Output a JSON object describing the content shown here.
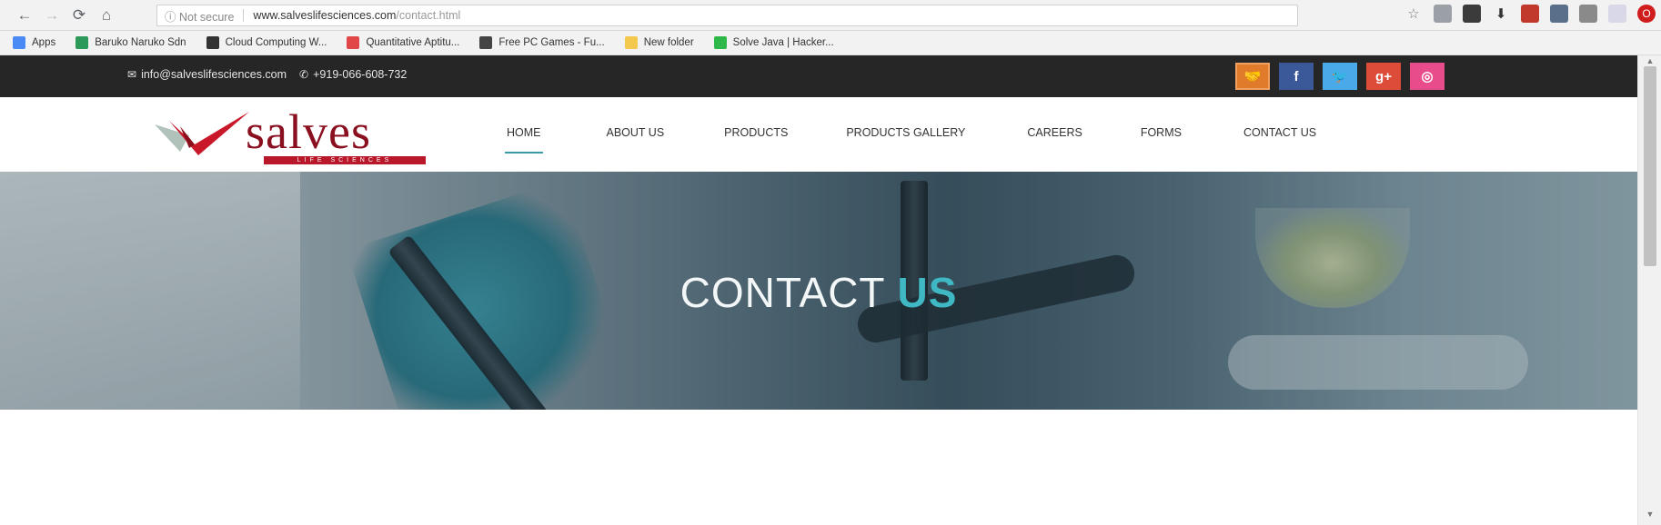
{
  "browser": {
    "nav": {
      "back": "←",
      "forward": "→",
      "reload": "⟳",
      "home": "⌂"
    },
    "security_label": "ⓘ Not secure",
    "url_host": "www.salveslifesciences.com",
    "url_path": "/contact.html"
  },
  "bookmarks": [
    {
      "label": "Apps",
      "color": "#4a8af4"
    },
    {
      "label": "Baruko Naruko Sdn",
      "color": "#2e9a5a"
    },
    {
      "label": "Cloud Computing W...",
      "color": "#333333"
    },
    {
      "label": "Quantitative Aptitu...",
      "color": "#e04848"
    },
    {
      "label": "Free PC Games - Fu...",
      "color": "#444444"
    },
    {
      "label": "New folder",
      "color": "#f2c94c"
    },
    {
      "label": "Solve Java | Hacker...",
      "color": "#2eb84a"
    }
  ],
  "topbar": {
    "email": "info@salveslifesciences.com",
    "phone": "+919-066-608-732"
  },
  "logo": {
    "word": "salves",
    "tagline": "LIFE SCIENCES"
  },
  "menu": [
    "HOME",
    "ABOUT US",
    "PRODUCTS",
    "PRODUCTS GALLERY",
    "CAREERS",
    "FORMS",
    "CONTACT US"
  ],
  "hero": {
    "title_light": "CONTACT ",
    "title_bold": "US"
  },
  "colors": {
    "topbar_bg": "#262626",
    "accent": "#3fb8c3",
    "brand_red": "#b8182a",
    "social_hands": "#e07b2b",
    "social_facebook": "#3b5998",
    "social_twitter": "#4aa9e9",
    "social_google": "#dd4b39",
    "social_dribbble": "#e84c8a"
  }
}
